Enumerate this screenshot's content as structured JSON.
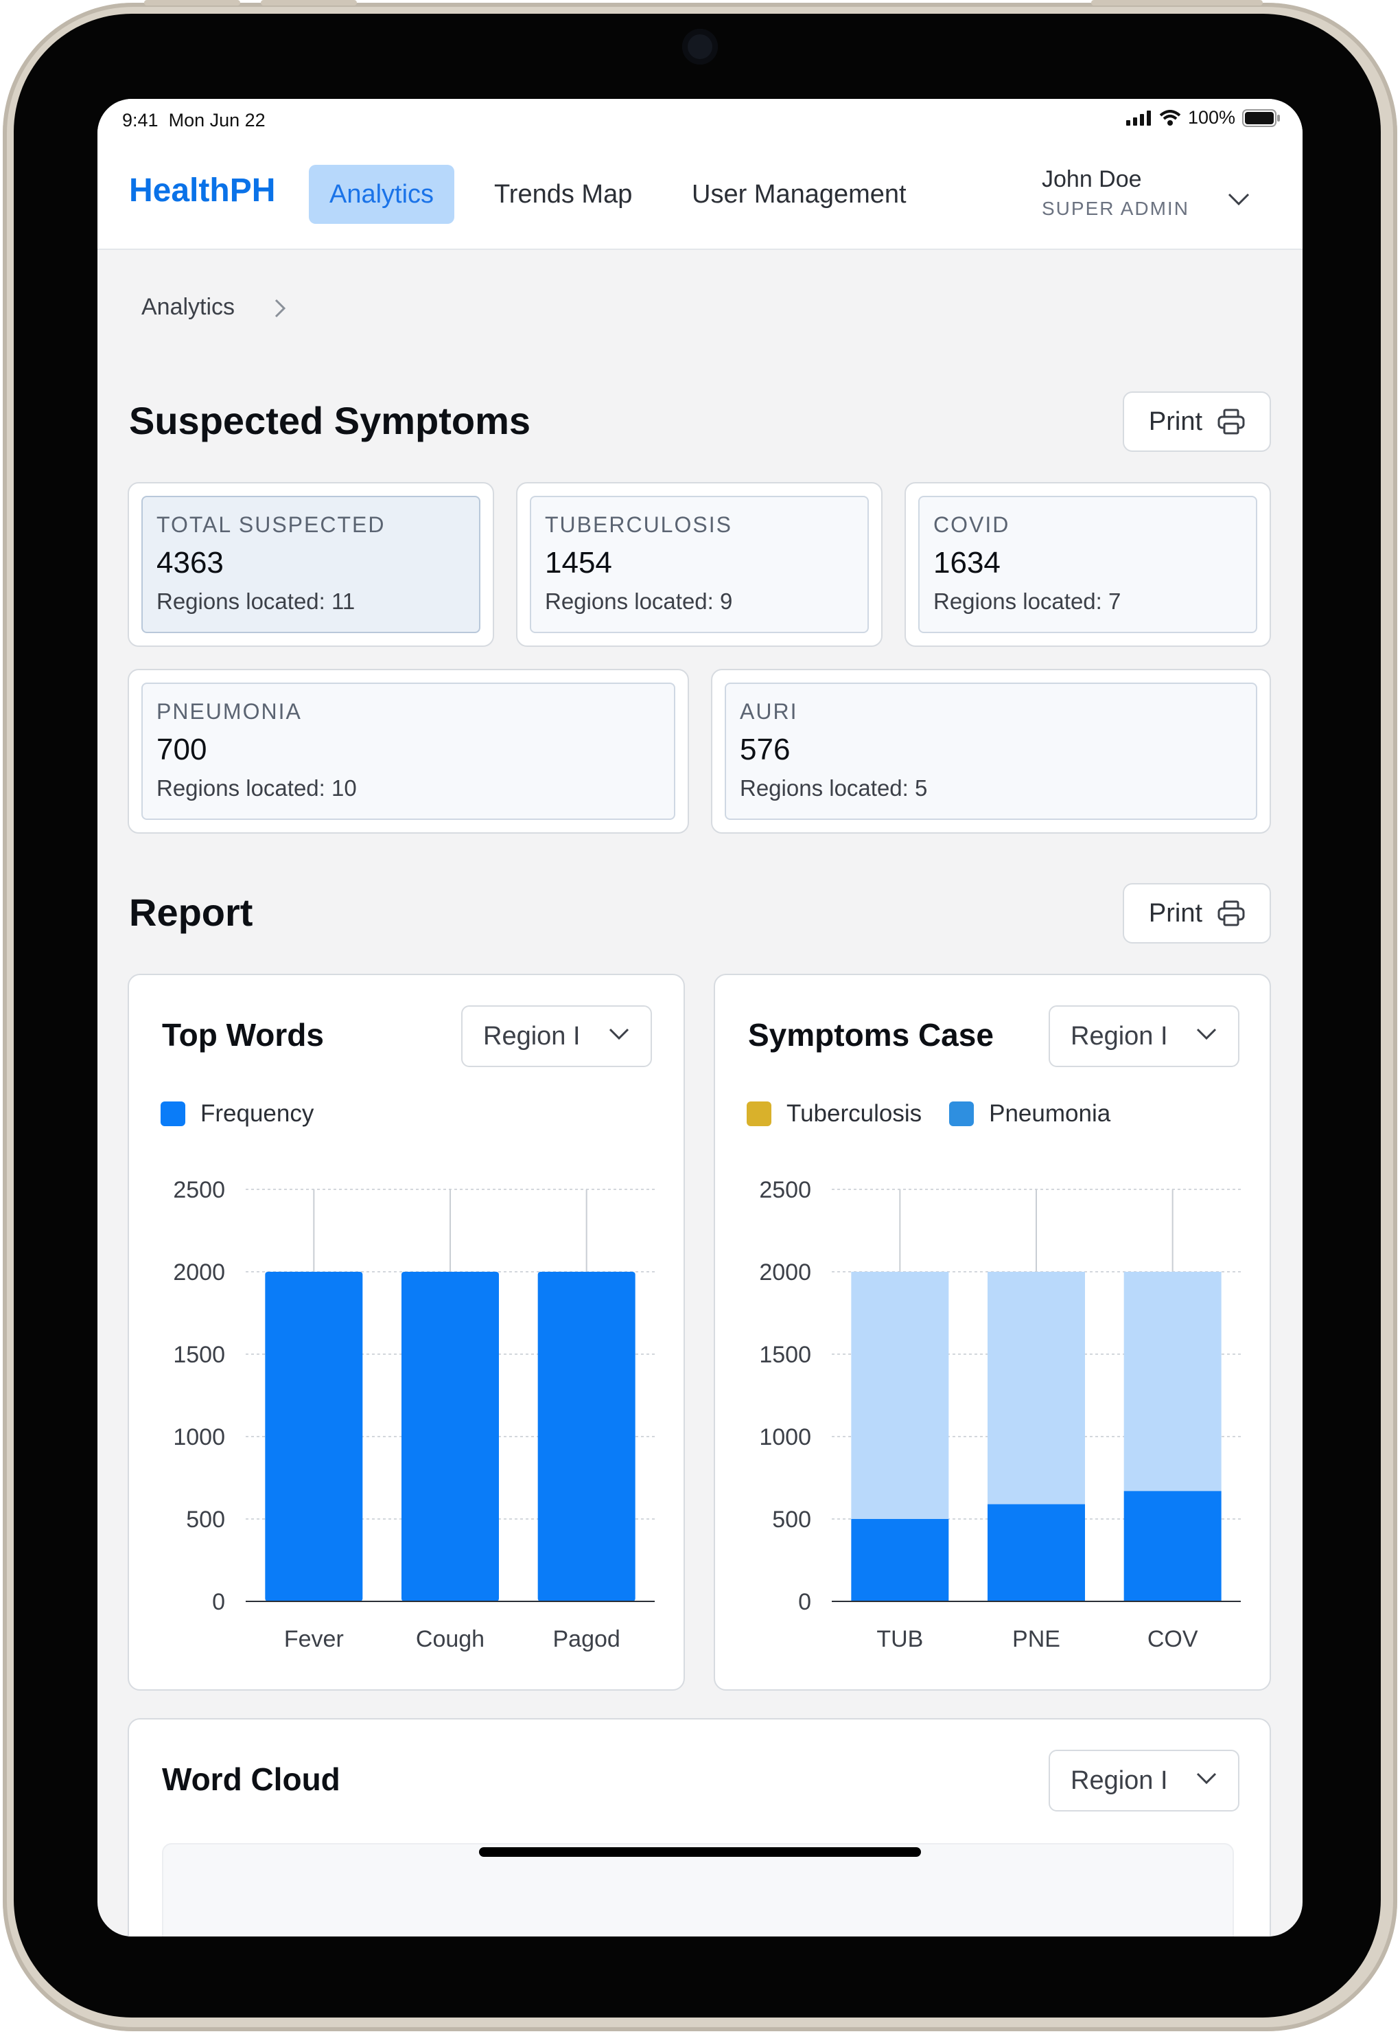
{
  "status_bar": {
    "time": "9:41",
    "date": "Mon Jun 22",
    "battery": "100%"
  },
  "nav": {
    "brand": "HealthPH",
    "tabs": [
      {
        "label": "Analytics",
        "active": true
      },
      {
        "label": "Trends Map",
        "active": false
      },
      {
        "label": "User Management",
        "active": false
      }
    ],
    "user": {
      "name": "John Doe",
      "role": "SUPER ADMIN"
    }
  },
  "breadcrumb": {
    "label": "Analytics"
  },
  "symptoms": {
    "title": "Suspected Symptoms",
    "print_label": "Print",
    "cards": [
      {
        "label": "TOTAL SUSPECTED",
        "value": "4363",
        "sub": "Regions located: 11"
      },
      {
        "label": "TUBERCULOSIS",
        "value": "1454",
        "sub": "Regions located: 9"
      },
      {
        "label": "COVID",
        "value": "1634",
        "sub": "Regions located: 7"
      },
      {
        "label": "PNEUMONIA",
        "value": "700",
        "sub": "Regions located: 10"
      },
      {
        "label": "AURI",
        "value": "576",
        "sub": "Regions located: 5"
      }
    ]
  },
  "report": {
    "title": "Report",
    "print_label": "Print"
  },
  "top_words": {
    "title": "Top Words",
    "region": "Region I"
  },
  "symptoms_case": {
    "title": "Symptoms Case",
    "region": "Region I"
  },
  "word_cloud": {
    "title": "Word Cloud",
    "region": "Region I"
  },
  "colors": {
    "accent": "#1a73e8",
    "bar": "#0a7cf8",
    "bar_light": "#b9d9fb",
    "tuberculosis": "#d9b12b",
    "pneumonia": "#2e8fe0"
  },
  "chart_data": [
    {
      "type": "bar",
      "title": "Top Words",
      "categories": [
        "Fever",
        "Cough",
        "Pagod"
      ],
      "series": [
        {
          "name": "Frequency",
          "values": [
            2000,
            2000,
            2000
          ]
        }
      ],
      "yticks": [
        "0",
        "500",
        "1000",
        "1500",
        "2000",
        "2500"
      ],
      "ylim": [
        0,
        2500
      ],
      "grid": true,
      "legend": "top-left"
    },
    {
      "type": "bar",
      "title": "Symptoms Case",
      "stacked": true,
      "categories": [
        "TUB",
        "PNE",
        "COV"
      ],
      "series": [
        {
          "name": "Tuberculosis",
          "values": [
            1500,
            1410,
            1330
          ]
        },
        {
          "name": "Pneumonia",
          "values": [
            500,
            590,
            670
          ]
        }
      ],
      "yticks": [
        "0",
        "500",
        "1000",
        "1500",
        "2000",
        "2500"
      ],
      "ylim": [
        0,
        2500
      ],
      "grid": true,
      "legend": "top-left"
    }
  ]
}
